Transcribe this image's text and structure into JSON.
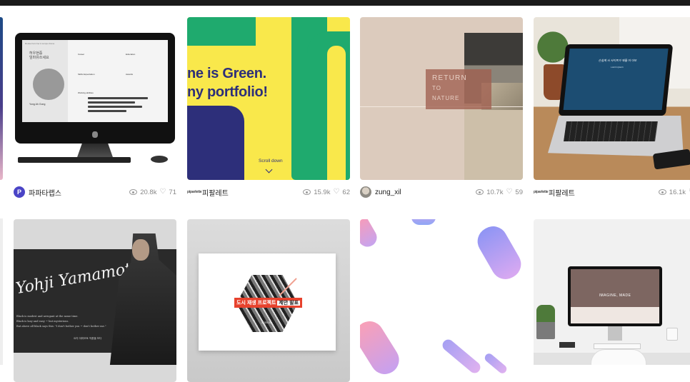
{
  "cards_row1": [
    {
      "author": "파파타랩스",
      "avatar_type": "letter",
      "avatar_letter": "P",
      "views": "20.8k",
      "likes": "71",
      "thumb": {
        "header_text": "Rooke ham her A sompo frame",
        "name_ko": "허우현증\n임마유쓰세요",
        "person_name": "Yong Ah Gong",
        "section_titles": [
          "Career",
          "Education",
          "Skills Expectation",
          "Awards",
          "Working abilities"
        ]
      }
    },
    {
      "author": "피팔레트",
      "avatar_type": "logo",
      "avatar_logo": "piparlette",
      "views": "15.9k",
      "likes": "62",
      "thumb": {
        "line1": "ne is Green.",
        "line2": "ny portfolio!",
        "scroll": "Scroll down"
      }
    },
    {
      "author": "zung_xil",
      "avatar_type": "photo",
      "views": "10.7k",
      "likes": "59",
      "thumb": {
        "title_lines": [
          "RETURN",
          "TO",
          "NATURE"
        ]
      }
    },
    {
      "author": "피팔레트",
      "avatar_type": "logo",
      "avatar_logo": "piparlette",
      "views": "16.1k",
      "likes": "",
      "thumb": {
        "screen_text": "손쉽게 사 사이트가 제를 어 아보",
        "screen_sub": "Lorem Ipsum"
      }
    }
  ],
  "cards_row2": [
    {
      "thumb": {
        "signature": "Yohji Yamamoto",
        "quote": "Black is modest and arrogant at the same time.\nBlack is lazy and easy ~ but mysterious.\nBut above all black says this: \"I don't bother you ~ don't bother me.\"",
        "credit": "요지 야마모토 작품을 보다"
      }
    },
    {
      "thumb": {
        "title": "도시 재생 프로젝트",
        "title_suffix": "제안 발표",
        "date": "2020.06"
      }
    },
    {
      "thumb": {}
    },
    {
      "thumb": {
        "screen_title": "IMAGINE, MADE"
      }
    }
  ],
  "icons": {
    "views": "eye-icon",
    "likes": "heart-icon"
  },
  "colors": {
    "topbar": "#1b1b1b",
    "green": "#1faa6e",
    "yellow": "#f9e84b",
    "navy": "#2d2f7a",
    "beige": "#dccbbd",
    "orange_red": "#e7422d"
  }
}
